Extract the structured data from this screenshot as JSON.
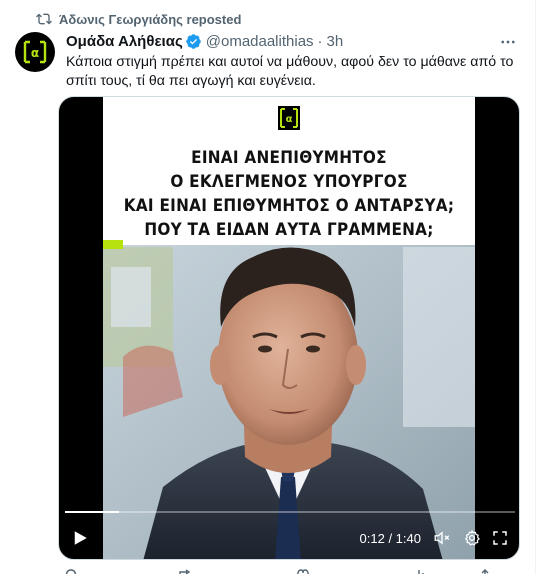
{
  "repost": {
    "label": "Άδωνις Γεωργιάδης reposted"
  },
  "author": {
    "name": "Ομάδα Αλήθειας",
    "handle": "@omadaalithias",
    "separator": "·",
    "time": "3h"
  },
  "post": {
    "text": "Κάποια στιγμή πρέπει και αυτοί να μάθουν, αφού δεν το μάθανε από το σπίτι τους, τί θα πει αγωγή και ευγένεια."
  },
  "video": {
    "headline": [
      "ΕΙΝΑΙ ΑΝΕΠΙΘΥΜΗΤΟΣ",
      "Ο ΕΚΛΕΓΜΕΝΟΣ ΥΠΟΥΡΓΟΣ",
      "ΚΑΙ ΕΙΝΑΙ ΕΠΙΘΥΜΗΤΟΣ Ο ΑΝΤΑΡΣΥΑ;",
      "ΠΟΥ ΤΑ ΕΙΔΑΝ ΑΥΤΑ ΓΡΑΜΜΕΝΑ;"
    ],
    "time_display": "0:12 / 1:40",
    "progress": 0.12,
    "brand_color": "#b6e310"
  },
  "icons": {
    "repost": "repost-icon",
    "verified": "verified-badge-icon",
    "more": "more-options-icon",
    "play": "play-icon",
    "volume": "volume-icon",
    "settings": "gear-icon",
    "fullscreen": "fullscreen-icon"
  }
}
